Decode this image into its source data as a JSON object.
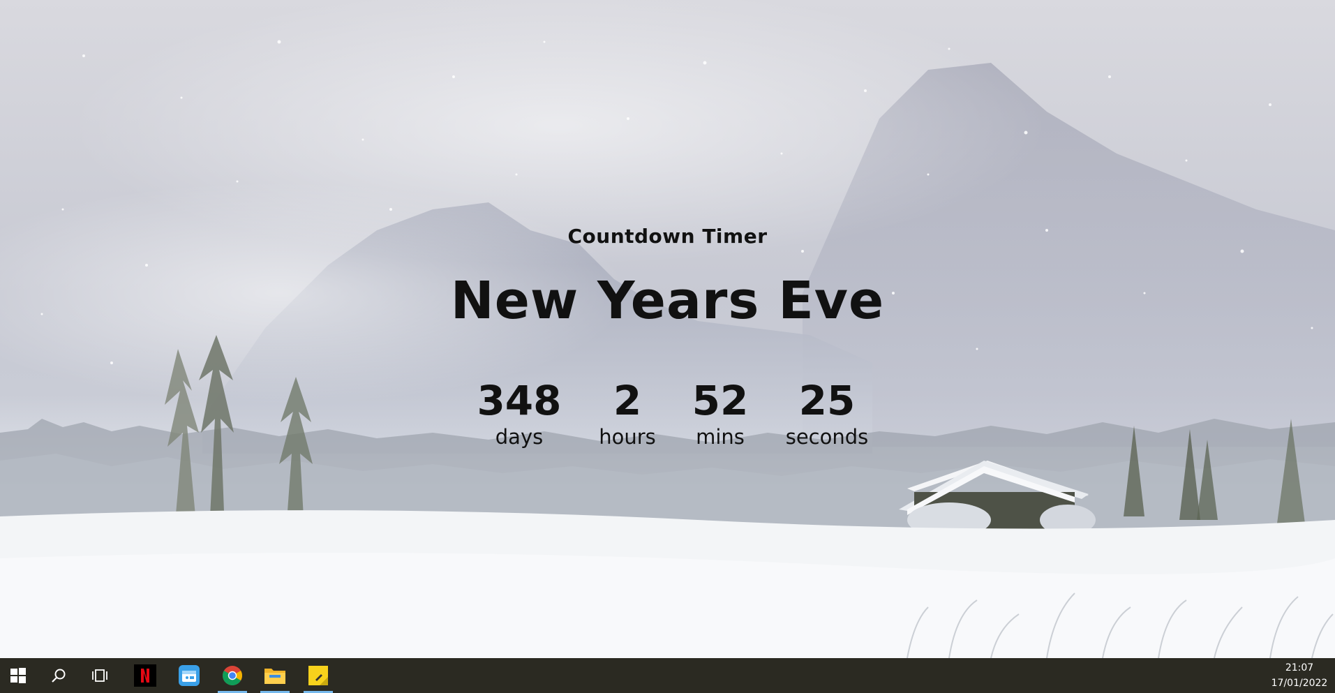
{
  "countdown": {
    "subtitle": "Countdown Timer",
    "title": "New Years Eve",
    "units": [
      {
        "value": "348",
        "label": "days"
      },
      {
        "value": "2",
        "label": "hours"
      },
      {
        "value": "52",
        "label": "mins"
      },
      {
        "value": "25",
        "label": "seconds"
      }
    ]
  },
  "taskbar": {
    "apps": [
      {
        "icon": "windows-start-icon"
      },
      {
        "icon": "search-icon"
      },
      {
        "icon": "task-view-icon"
      },
      {
        "icon": "netflix-icon"
      },
      {
        "icon": "app-icon"
      },
      {
        "icon": "chrome-icon",
        "active": true
      },
      {
        "icon": "file-explorer-icon",
        "active": true
      },
      {
        "icon": "sticky-notes-icon",
        "active": true
      }
    ],
    "time": "21:07",
    "date": "17/01/2022",
    "active_indicator_color": "#76b9ed",
    "background_color": "#2b2a22"
  }
}
